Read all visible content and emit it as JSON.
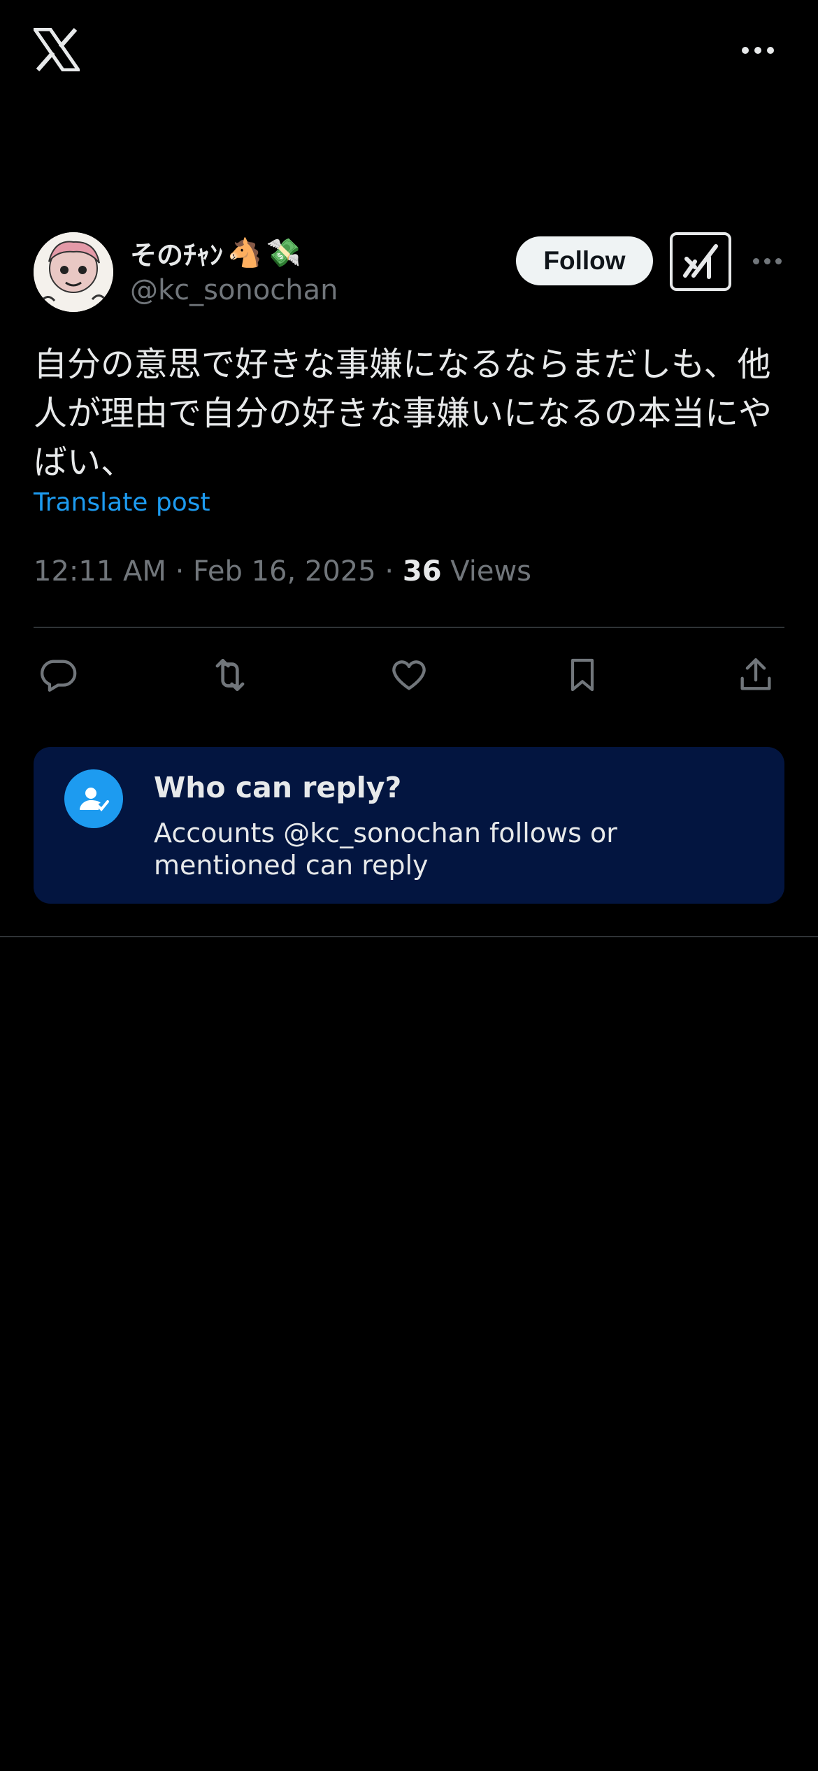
{
  "header": {
    "logo_icon": "x-logo-icon",
    "more_icon": "more-horizontal-icon"
  },
  "author": {
    "display_name": "そのﾁｬﾝ",
    "emoji_1": "🐴",
    "emoji_2": "💸",
    "handle": "@kc_sonochan",
    "follow_label": "Follow",
    "grok_icon": "grok-icon",
    "more_icon": "more-horizontal-icon"
  },
  "post": {
    "text": "自分の意思で好きな事嫌になるならまだしも、他人が理由で自分の好きな事嫌いになるの本当にやばい、",
    "translate_label": "Translate post",
    "time": "12:11 AM",
    "sep1": " · ",
    "date": "Feb 16, 2025",
    "sep2": " · ",
    "views_count": "36",
    "views_label": " Views"
  },
  "actions": {
    "icons": [
      "reply-icon",
      "repost-icon",
      "like-icon",
      "bookmark-icon",
      "share-icon"
    ]
  },
  "reply_restriction": {
    "title": "Who can reply?",
    "description": "Accounts @kc_sonochan follows or mentioned can reply",
    "icon": "person-check-icon"
  },
  "colors": {
    "background": "#000000",
    "text": "#e7e9ea",
    "muted": "#71767b",
    "accent": "#1d9bf0",
    "card_bg": "#031540"
  }
}
